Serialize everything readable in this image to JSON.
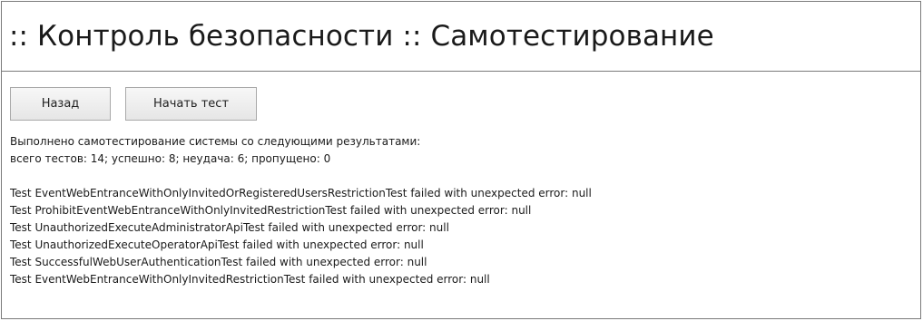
{
  "header": {
    "title": ":: Контроль безопасности :: Самотестирование"
  },
  "buttons": {
    "back_label": "Назад",
    "start_label": "Начать тест"
  },
  "summary": {
    "intro": "Выполнено самотестирование системы со следующими результатами:",
    "stats": "всего тестов: 14; успешно: 8; неудача: 6; пропущено: 0"
  },
  "failures": [
    "Test EventWebEntranceWithOnlyInvitedOrRegisteredUsersRestrictionTest failed with unexpected error: null",
    "Test ProhibitEventWebEntranceWithOnlyInvitedRestrictionTest failed with unexpected error: null",
    "Test UnauthorizedExecuteAdministratorApiTest failed with unexpected error: null",
    "Test UnauthorizedExecuteOperatorApiTest failed with unexpected error: null",
    "Test SuccessfulWebUserAuthenticationTest failed with unexpected error: null",
    "Test EventWebEntranceWithOnlyInvitedRestrictionTest failed with unexpected error: null"
  ]
}
